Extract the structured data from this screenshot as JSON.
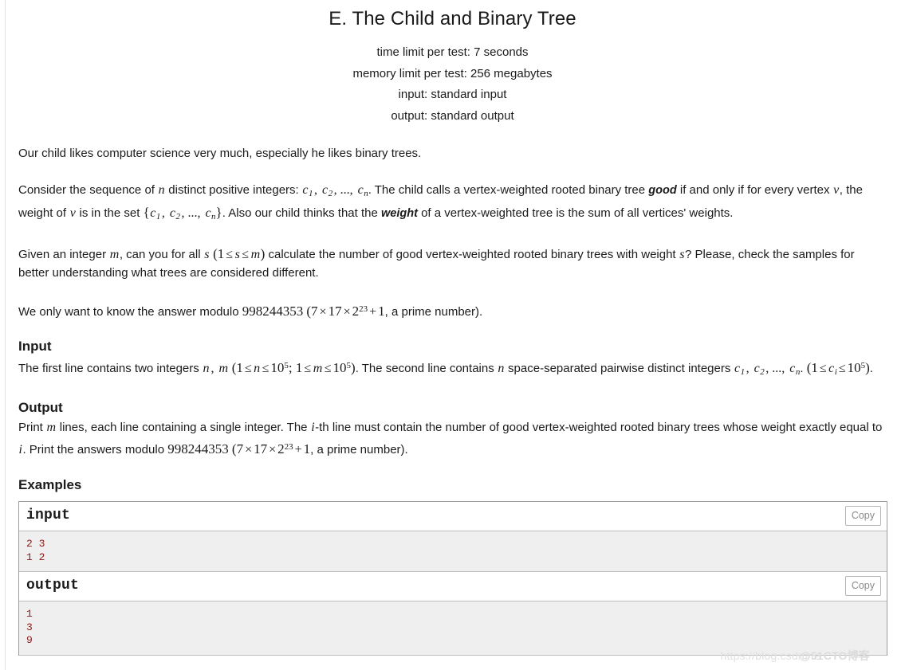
{
  "problem": {
    "title": "E. The Child and Binary Tree",
    "limits": [
      "time limit per test: 7 seconds",
      "memory limit per test: 256 megabytes",
      "input: standard input",
      "output: standard output"
    ]
  },
  "statement": {
    "p1": "Our child likes computer science very much, especially he likes binary trees.",
    "p2": {
      "s1": "Consider the sequence of ",
      "v_n": "n",
      "s2": " distinct positive integers: ",
      "c1": "c",
      "c1s": "1",
      "comma1": ", ",
      "c2": "c",
      "c2s": "2",
      "dots": ", ..., ",
      "cn": "c",
      "cns": "n",
      "s3": ". The child calls a vertex-weighted rooted binary tree ",
      "em_good": "good",
      "s4": " if and only if for every vertex ",
      "v_v1": "v",
      "s5": ", the weight of ",
      "v_v2": "v",
      "s6": " is in the set ",
      "setopen": "{",
      "setclose": "}",
      "s7": ". Also our child thinks that the ",
      "em_weight": "weight",
      "s8": " of a vertex-weighted tree is the sum of all vertices' weights."
    },
    "p3": {
      "s1": "Given an integer ",
      "v_m": "m",
      "s2": ", can you for all ",
      "v_s": "s",
      "paren_open": "(",
      "one": "1",
      "le1": "≤",
      "v_s2": "s",
      "le2": "≤",
      "v_m2": "m",
      "paren_close": ")",
      "s3": " calculate the number of good vertex-weighted rooted binary trees with weight ",
      "v_s3": "s",
      "s4": "? Please, check the samples for better understanding what trees are considered different."
    },
    "p4": {
      "s1": "We only want to know the answer modulo ",
      "mod": "998244353",
      "paren_open": "(",
      "seven": "7",
      "times1": "×",
      "seventeen": "17",
      "times2": "×",
      "two": "2",
      "exp": "23",
      "plus": "+",
      "one": "1",
      "s2": ", a prime number)."
    }
  },
  "input_section": {
    "heading": "Input",
    "s1": "The first line contains two integers ",
    "v_n": "n",
    "comma": ", ",
    "v_m": "m",
    "paren_open": "(",
    "one_a": "1",
    "le_a1": "≤",
    "v_n2": "n",
    "le_a2": "≤",
    "ten_a": "10",
    "exp_a": "5",
    "semi": "; ",
    "one_b": "1",
    "le_b1": "≤",
    "v_m2": "m",
    "le_b2": "≤",
    "ten_b": "10",
    "exp_b": "5",
    "paren_close": ")",
    "s2": ". The second line contains ",
    "v_n3": "n",
    "s3": " space-separated pairwise distinct integers ",
    "c1": "c",
    "c1s": "1",
    "c2": "c",
    "c2s": "2",
    "dots": ", ..., ",
    "cn": "c",
    "cns": "n",
    "s4": ". ",
    "p2_open": "(",
    "one_c": "1",
    "le_c1": "≤",
    "ci": "c",
    "cis": "i",
    "le_c2": "≤",
    "ten_c": "10",
    "exp_c": "5",
    "p2_close": ")",
    "s5": "."
  },
  "output_section": {
    "heading": "Output",
    "s1": "Print ",
    "v_m": "m",
    "s2": " lines, each line containing a single integer. The ",
    "v_i": "i",
    "s3": "-th line must contain the number of good vertex-weighted rooted binary trees whose weight exactly equal to ",
    "v_i2": "i",
    "s4": ". Print the answers modulo ",
    "mod": "998244353",
    "paren_open": "(",
    "seven": "7",
    "times1": "×",
    "seventeen": "17",
    "times2": "×",
    "two": "2",
    "exp": "23",
    "plus": "+",
    "one": "1",
    "s5": ", a prime number)."
  },
  "examples": {
    "heading": "Examples",
    "copy_label": "Copy",
    "blocks": [
      {
        "label": "input",
        "lines": [
          "2 3",
          "1 2"
        ]
      },
      {
        "label": "output",
        "lines": [
          "1",
          "3",
          "9"
        ]
      }
    ]
  },
  "watermark": {
    "url": "https://blog.csdn.ne",
    "cn": "@51CTO博客"
  },
  "colors": {
    "sample_text": "#8b1a1a",
    "sample_bg": "#efefef",
    "border": "#9e9e9e",
    "text": "#1b1b1b"
  }
}
